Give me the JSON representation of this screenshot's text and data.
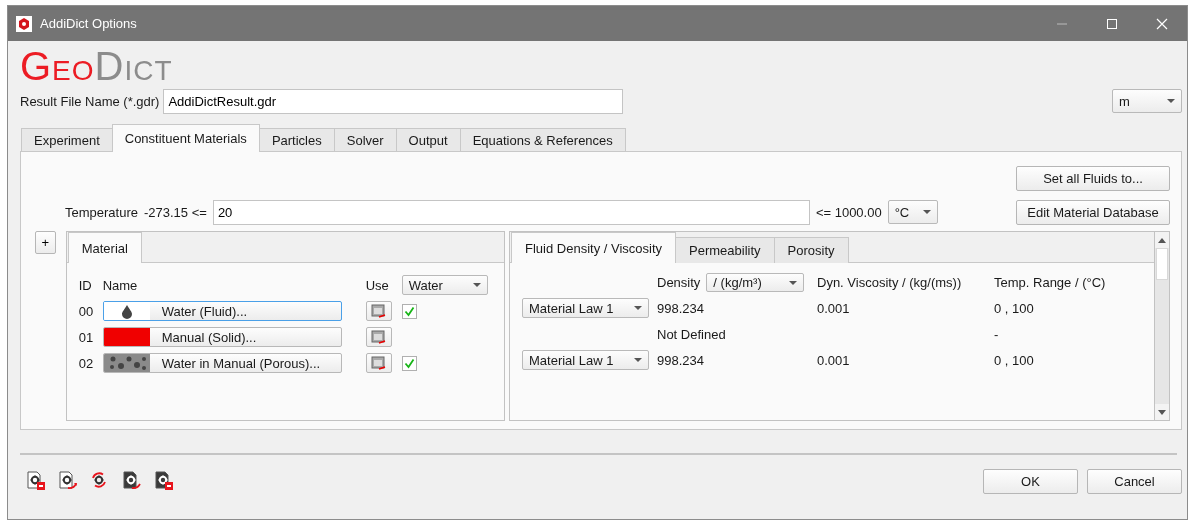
{
  "window": {
    "title": "AddiDict Options"
  },
  "logo": {
    "part_1": "Geo",
    "part_2": "Dict"
  },
  "result_file": {
    "label": "Result File Name (*.gdr)",
    "value": "AddiDictResult.gdr"
  },
  "unit_select": {
    "value": "m"
  },
  "tabs": [
    {
      "label": "Experiment",
      "selected": false
    },
    {
      "label": "Constituent Materials",
      "selected": true
    },
    {
      "label": "Particles",
      "selected": false
    },
    {
      "label": "Solver",
      "selected": false
    },
    {
      "label": "Output",
      "selected": false
    },
    {
      "label": "Equations & References",
      "selected": false
    }
  ],
  "temperature": {
    "label": "Temperature",
    "min": "-273.15 <=",
    "value": "20",
    "max": "<= 1000.00",
    "unit": "°C"
  },
  "side_buttons": [
    "Set all Fluids to...",
    "Edit Material Database"
  ],
  "add_button": "+",
  "material_panel": {
    "tabs": [
      {
        "label": "Material",
        "selected": true
      }
    ],
    "columns": [
      "ID",
      "Name",
      "Use"
    ],
    "use_select": "Water",
    "rows": [
      {
        "id": "00",
        "name": "Water (Fluid)...",
        "kind": "fluid",
        "selected": true,
        "checked": true
      },
      {
        "id": "01",
        "name": "Manual (Solid)...",
        "kind": "solid",
        "selected": false
      },
      {
        "id": "02",
        "name": "Water in Manual (Porous)...",
        "kind": "porous",
        "selected": false,
        "checked": true
      }
    ]
  },
  "properties_panel": {
    "tabs": [
      {
        "label": "Fluid Density / Viscosity",
        "selected": true
      },
      {
        "label": "Permeability",
        "selected": false
      },
      {
        "label": "Porosity",
        "selected": false
      }
    ],
    "density_label": "Density",
    "density_unit": "/ (kg/m³)",
    "columns": [
      "Dyn. Viscosity / (kg/(ms))",
      "Temp. Range / (°C)"
    ],
    "rows": [
      {
        "law": "Material Law 1",
        "density": "998.234",
        "viscosity": "0.001",
        "temp_range": "0 , 100"
      },
      {
        "density": "Not Defined",
        "temp_range": "-"
      },
      {
        "law": "Material Law 1",
        "density": "998.234",
        "viscosity": "0.001",
        "temp_range": "0 , 100"
      }
    ]
  },
  "footer_buttons": [
    "OK",
    "Cancel"
  ]
}
